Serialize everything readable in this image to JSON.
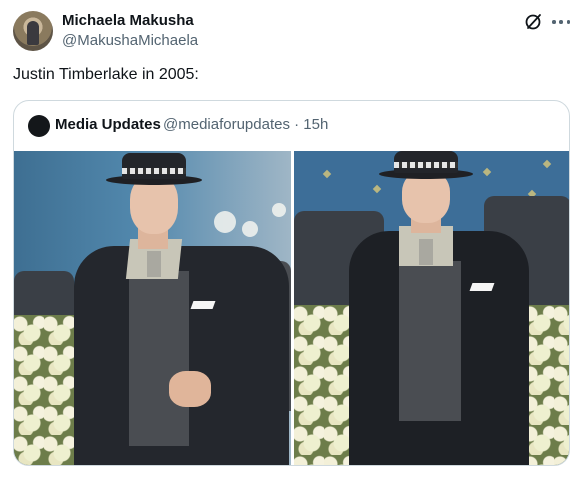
{
  "tweet": {
    "author_name": "Michaela Makusha",
    "author_handle": "@MakushaMichaela",
    "text": "Justin Timberlake in 2005:"
  },
  "quoted_tweet": {
    "author_name": "Media Updates",
    "meta": "@mediaforupdates · 15h"
  },
  "icons": {
    "grok": "grok-slash-circle-icon",
    "more": "more-dots-icon"
  },
  "colors": {
    "text_primary": "#0f1419",
    "text_secondary": "#536471",
    "border": "#cfd9de"
  }
}
